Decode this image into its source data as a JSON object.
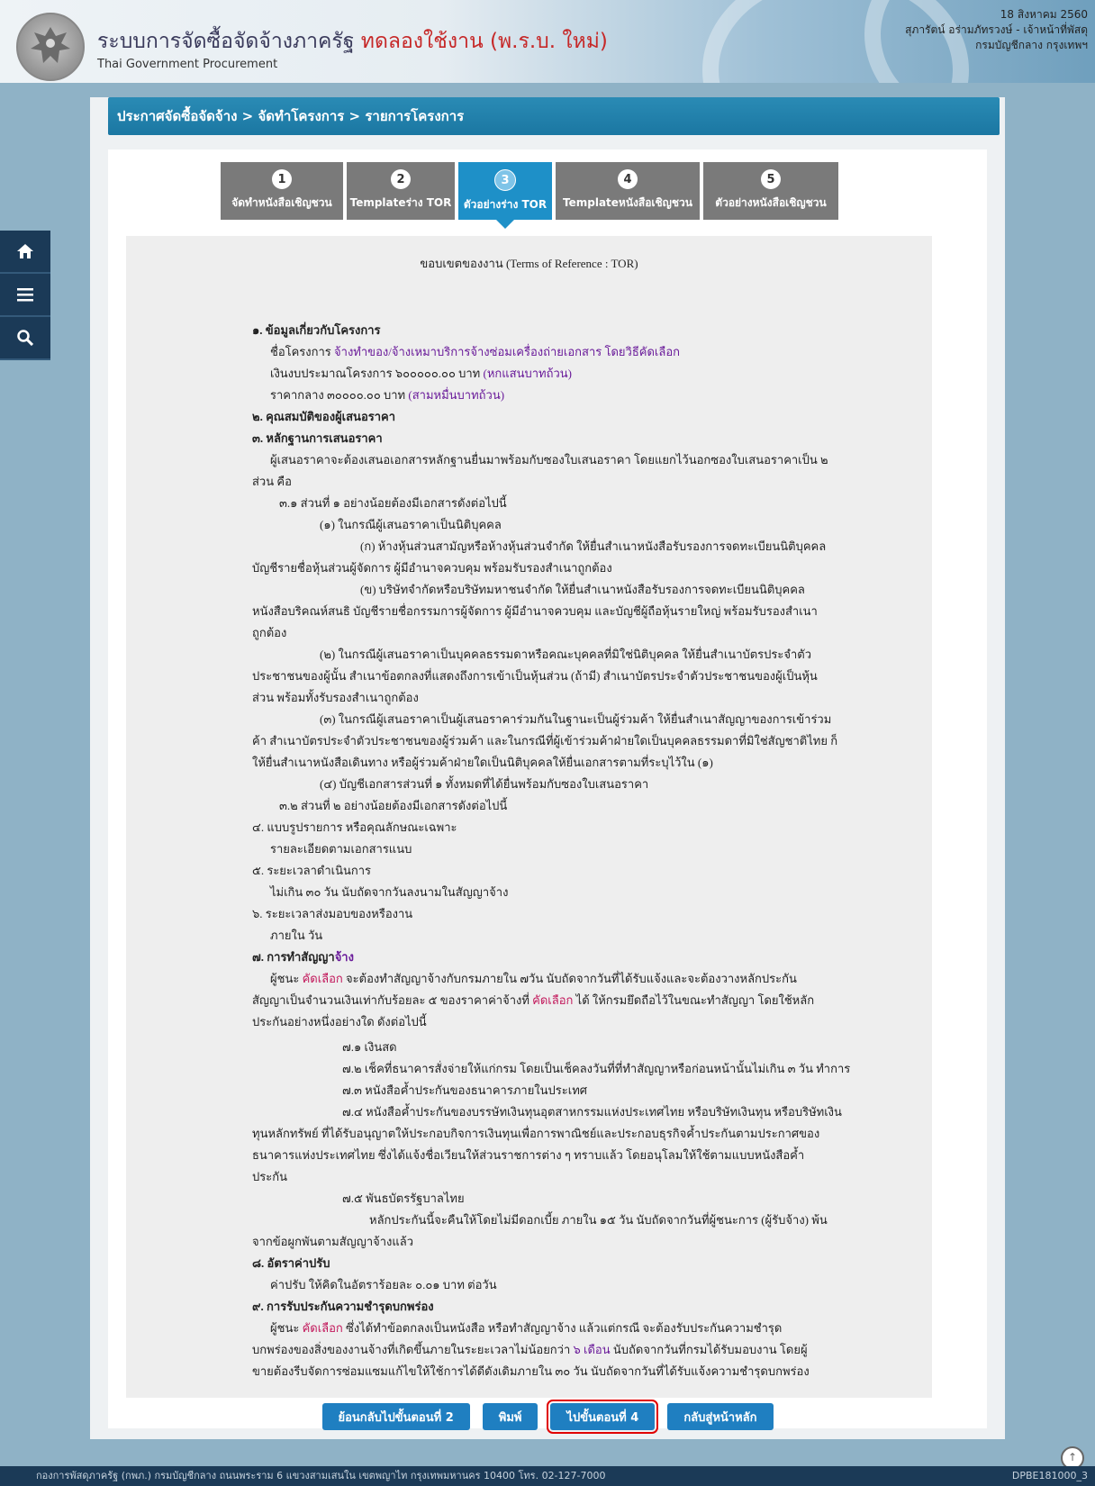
{
  "header": {
    "title_main": "ระบบการจัดซื้อจัดจ้างภาครัฐ",
    "title_beta": "ทดลองใช้งาน (พ.ร.บ. ใหม่)",
    "subtitle": "Thai Government Procurement",
    "date": "18 สิงหาคม 2560",
    "user": "สุภารัตน์ อร่ามภัทรวงษ์ - เจ้าหน้าที่พัสดุ",
    "org": "กรมบัญชีกลาง กรุงเทพฯ"
  },
  "nav": {
    "home_icon": "home-icon",
    "menu_icon": "menu-icon",
    "search_icon": "search-icon"
  },
  "breadcrumb": "ประกาศจัดซื้อจัดจ้าง > จัดทำโครงการ > รายการโครงการ",
  "steps": [
    {
      "num": "1",
      "label": "จัดทำหนังสือเชิญชวน"
    },
    {
      "num": "2",
      "label": "Templateร่าง TOR"
    },
    {
      "num": "3",
      "label": "ตัวอย่างร่าง TOR"
    },
    {
      "num": "4",
      "label": "Templateหนังสือเชิญชวน"
    },
    {
      "num": "5",
      "label": "ตัวอย่างหนังสือเชิญชวน"
    }
  ],
  "doc": {
    "heading": "ขอบเขตของงาน (Terms of Reference : TOR)",
    "lines": [
      "๑. ข้อมูลเกี่ยวกับโครงการ",
      "ชื่อโครงการ",
      "จ้างทำของ/จ้างเหมาบริการจ้างซ่อมเครื่องถ่ายเอกสาร โดยวิธีคัดเลือก",
      "เงินงบประมาณโครงการ ๖๐๐๐๐๐.๐๐ บาท",
      "(หกแสนบาทถ้วน)",
      "ราคากลาง ๓๐๐๐๐.๐๐ บาท",
      "(สามหมื่นบาทถ้วน)",
      "๒. คุณสมบัติของผู้เสนอราคา",
      "๓. หลักฐานการเสนอราคา",
      "ผู้เสนอราคาจะต้องเสนอเอกสารหลักฐานยื่นมาพร้อมกับซองใบเสนอราคา โดยแยกไว้นอกซองใบเสนอราคาเป็น ๒",
      "ส่วน คือ",
      "๓.๑   ส่วนที่ ๑ อย่างน้อยต้องมีเอกสารดังต่อไปนี้",
      "(๑) ในกรณีผู้เสนอราคาเป็นนิติบุคคล",
      "(ก) ห้างหุ้นส่วนสามัญหรือห้างหุ้นส่วนจำกัด ให้ยื่นสำเนาหนังสือรับรองการจดทะเบียนนิติบุคคล",
      "บัญชีรายชื่อหุ้นส่วนผู้จัดการ ผู้มีอำนาจควบคุม พร้อมรับรองสำเนาถูกต้อง",
      "(ข) บริษัทจำกัดหรือบริษัทมหาชนจำกัด ให้ยื่นสำเนาหนังสือรับรองการจดทะเบียนนิติบุคคล",
      "หนังสือบริคณห์สนธิ บัญชีรายชื่อกรรมการผู้จัดการ ผู้มีอำนาจควบคุม และบัญชีผู้ถือหุ้นรายใหญ่ พร้อมรับรองสำเนา",
      "ถูกต้อง",
      "(๒) ในกรณีผู้เสนอราคาเป็นบุคคลธรรมดาหรือคณะบุคคลที่มิใช่นิติบุคคล ให้ยื่นสำเนาบัตรประจำตัว",
      "ประชาชนของผู้นั้น สำเนาข้อตกลงที่แสดงถึงการเข้าเป็นหุ้นส่วน (ถ้ามี) สำเนาบัตรประจำตัวประชาชนของผู้เป็นหุ้น",
      "ส่วน พร้อมทั้งรับรองสำเนาถูกต้อง",
      "(๓) ในกรณีผู้เสนอราคาเป็นผู้เสนอราคาร่วมกันในฐานะเป็นผู้ร่วมค้า ให้ยื่นสำเนาสัญญาของการเข้าร่วม",
      "ค้า สำเนาบัตรประจำตัวประชาชนของผู้ร่วมค้า และในกรณีที่ผู้เข้าร่วมค้าฝ่ายใดเป็นบุคคลธรรมดาที่มิใช่สัญชาติไทย ก็",
      "ให้ยื่นสำเนาหนังสือเดินทาง หรือผู้ร่วมค้าฝ่ายใดเป็นนิติบุคคลให้ยื่นเอกสารตามที่ระบุไว้ใน (๑)",
      "(๔) บัญชีเอกสารส่วนที่ ๑ ทั้งหมดที่ได้ยื่นพร้อมกับซองใบเสนอราคา",
      "๓.๒   ส่วนที่ ๒ อย่างน้อยต้องมีเอกสารดังต่อไปนี้",
      "๔. แบบรูปรายการ หรือคุณลักษณะเฉพาะ",
      "รายละเอียดตามเอกสารแนบ",
      "๕. ระยะเวลาดำเนินการ",
      "ไม่เกิน ๓๐ วัน นับถัดจากวันลงนามในสัญญาจ้าง",
      "๖. ระยะเวลาส่งมอบของหรืองาน",
      "ภายใน วัน",
      "๗. การทำสัญญา",
      "จ้าง",
      "ผู้ชนะ",
      "คัดเลือก",
      "จะต้องทำสัญญาจ้างกับกรมภายใน ๗วัน นับถัดจากวันที่ได้รับแจ้งและจะต้องวางหลักประกัน",
      "สัญญาเป็นจำนวนเงินเท่ากับร้อยละ ๕ ของราคาค่าจ้างที่",
      "ได้ ให้กรมยึดถือไว้ในขณะทำสัญญา โดยใช้หลัก",
      "ประกันอย่างหนึ่งอย่างใด ดังต่อไปนี้",
      "๗.๑ เงินสด",
      "๗.๒ เช็คที่ธนาคารสั่งจ่ายให้แก่กรม โดยเป็นเช็คลงวันที่ที่ทำสัญญาหรือก่อนหน้านั้นไม่เกิน ๓ วัน ทำการ",
      "๗.๓ หนังสือค้ำประกันของธนาคารภายในประเทศ",
      "๗.๔ หนังสือค้ำประกันของบรรษัทเงินทุนอุตสาหกรรมแห่งประเทศไทย หรือบริษัทเงินทุน หรือบริษัทเงิน",
      "ทุนหลักทรัพย์ ที่ได้รับอนุญาตให้ประกอบกิจการเงินทุนเพื่อการพาณิชย์และประกอบธุรกิจค้ำประกันตามประกาศของ",
      "ธนาคารแห่งประเทศไทย ซึ่งได้แจ้งชื่อเวียนให้ส่วนราชการต่าง ๆ ทราบแล้ว โดยอนุโลมให้ใช้ตามแบบหนังสือค้ำ",
      "ประกัน",
      "๗.๕ พันธบัตรรัฐบาลไทย",
      "หลักประกันนี้จะคืนให้โดยไม่มีดอกเบี้ย ภายใน ๑๕ วัน นับถัดจากวันที่ผู้ชนะการ (ผู้รับจ้าง) พ้น",
      "จากข้อผูกพันตามสัญญาจ้างแล้ว",
      "๘. อัตราค่าปรับ",
      "ค่าปรับ ให้คิดในอัตราร้อยละ ๐.๐๑ บาท ต่อวัน",
      "๙. การรับประกันความชำรุดบกพร่อง",
      "ซึ่งได้ทำข้อตกลงเป็นหนังสือ หรือทำสัญญาจ้าง แล้วแต่กรณี จะต้องรับประกันความชำรุด",
      "บกพร่องของสิ่งของงานจ้างที่เกิดขึ้นภายในระยะเวลาไม่น้อยกว่า",
      "๖ เดือน",
      "นับถัดจากวันที่กรมได้รับมอบงาน โดยผู้",
      "ขายต้องรีบจัดการซ่อมแซมแก้ไขให้ใช้การได้ดีดังเดิมภายใน ๓๐ วัน นับถัดจากวันที่ได้รับแจ้งความชำรุดบกพร่อง"
    ]
  },
  "buttons": {
    "back": "ย้อนกลับไปขั้นตอนที่ 2",
    "print": "พิมพ์",
    "next": "ไปขั้นตอนที่ 4",
    "home": "กลับสู่หน้าหลัก"
  },
  "footer": {
    "text": "กองการพัสดุภาครัฐ (กพภ.) กรมบัญชีกลาง ถนนพระราม 6 แขวงสามเสนใน เขตพญาไท กรุงเทพมหานคร 10400 โทร. 02-127-7000",
    "code": "DPBE181000_3"
  }
}
